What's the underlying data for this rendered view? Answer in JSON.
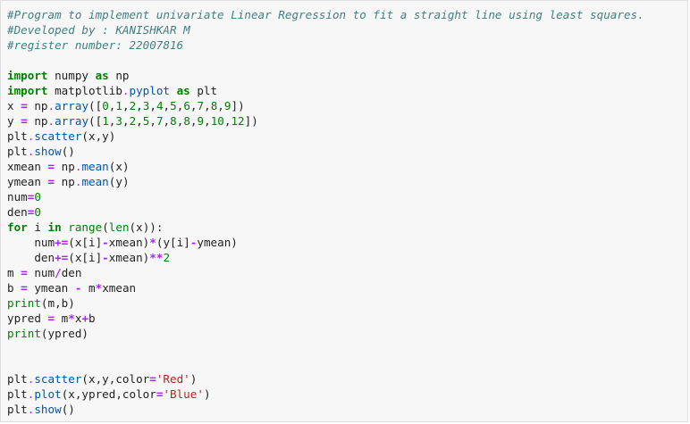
{
  "cell": {
    "lines": [
      [
        {
          "t": "comment",
          "v": "#Program to implement univariate Linear Regression to fit a straight line using least squares."
        }
      ],
      [
        {
          "t": "comment",
          "v": "#Developed by : KANISHKAR M"
        }
      ],
      [
        {
          "t": "comment",
          "v": "#register number: 22007816"
        }
      ],
      [],
      [
        {
          "t": "kw",
          "v": "import"
        },
        {
          "t": "text",
          "v": " numpy "
        },
        {
          "t": "kw",
          "v": "as"
        },
        {
          "t": "text",
          "v": " np"
        }
      ],
      [
        {
          "t": "kw",
          "v": "import"
        },
        {
          "t": "text",
          "v": " matplotlib"
        },
        {
          "t": "opn",
          "v": "."
        },
        {
          "t": "attr",
          "v": "pyplot"
        },
        {
          "t": "text",
          "v": " "
        },
        {
          "t": "kw",
          "v": "as"
        },
        {
          "t": "text",
          "v": " plt"
        }
      ],
      [
        {
          "t": "text",
          "v": "x "
        },
        {
          "t": "op",
          "v": "="
        },
        {
          "t": "text",
          "v": " np"
        },
        {
          "t": "opn",
          "v": "."
        },
        {
          "t": "attr",
          "v": "array"
        },
        {
          "t": "text",
          "v": "(["
        },
        {
          "t": "num",
          "v": "0"
        },
        {
          "t": "text",
          "v": ","
        },
        {
          "t": "num",
          "v": "1"
        },
        {
          "t": "text",
          "v": ","
        },
        {
          "t": "num",
          "v": "2"
        },
        {
          "t": "text",
          "v": ","
        },
        {
          "t": "num",
          "v": "3"
        },
        {
          "t": "text",
          "v": ","
        },
        {
          "t": "num",
          "v": "4"
        },
        {
          "t": "text",
          "v": ","
        },
        {
          "t": "num",
          "v": "5"
        },
        {
          "t": "text",
          "v": ","
        },
        {
          "t": "num",
          "v": "6"
        },
        {
          "t": "text",
          "v": ","
        },
        {
          "t": "num",
          "v": "7"
        },
        {
          "t": "text",
          "v": ","
        },
        {
          "t": "num",
          "v": "8"
        },
        {
          "t": "text",
          "v": ","
        },
        {
          "t": "num",
          "v": "9"
        },
        {
          "t": "text",
          "v": "])"
        }
      ],
      [
        {
          "t": "text",
          "v": "y "
        },
        {
          "t": "op",
          "v": "="
        },
        {
          "t": "text",
          "v": " np"
        },
        {
          "t": "opn",
          "v": "."
        },
        {
          "t": "attr",
          "v": "array"
        },
        {
          "t": "text",
          "v": "(["
        },
        {
          "t": "num",
          "v": "1"
        },
        {
          "t": "text",
          "v": ","
        },
        {
          "t": "num",
          "v": "3"
        },
        {
          "t": "text",
          "v": ","
        },
        {
          "t": "num",
          "v": "2"
        },
        {
          "t": "text",
          "v": ","
        },
        {
          "t": "num",
          "v": "5"
        },
        {
          "t": "text",
          "v": ","
        },
        {
          "t": "num",
          "v": "7"
        },
        {
          "t": "text",
          "v": ","
        },
        {
          "t": "num",
          "v": "8"
        },
        {
          "t": "text",
          "v": ","
        },
        {
          "t": "num",
          "v": "8"
        },
        {
          "t": "text",
          "v": ","
        },
        {
          "t": "num",
          "v": "9"
        },
        {
          "t": "text",
          "v": ","
        },
        {
          "t": "num",
          "v": "10"
        },
        {
          "t": "text",
          "v": ","
        },
        {
          "t": "num",
          "v": "12"
        },
        {
          "t": "text",
          "v": "])"
        }
      ],
      [
        {
          "t": "text",
          "v": "plt"
        },
        {
          "t": "opn",
          "v": "."
        },
        {
          "t": "attr",
          "v": "scatter"
        },
        {
          "t": "text",
          "v": "(x,y)"
        }
      ],
      [
        {
          "t": "text",
          "v": "plt"
        },
        {
          "t": "opn",
          "v": "."
        },
        {
          "t": "attr",
          "v": "show"
        },
        {
          "t": "text",
          "v": "()"
        }
      ],
      [
        {
          "t": "text",
          "v": "xmean "
        },
        {
          "t": "op",
          "v": "="
        },
        {
          "t": "text",
          "v": " np"
        },
        {
          "t": "opn",
          "v": "."
        },
        {
          "t": "attr",
          "v": "mean"
        },
        {
          "t": "text",
          "v": "(x)"
        }
      ],
      [
        {
          "t": "text",
          "v": "ymean "
        },
        {
          "t": "op",
          "v": "="
        },
        {
          "t": "text",
          "v": " np"
        },
        {
          "t": "opn",
          "v": "."
        },
        {
          "t": "attr",
          "v": "mean"
        },
        {
          "t": "text",
          "v": "(y)"
        }
      ],
      [
        {
          "t": "text",
          "v": "num"
        },
        {
          "t": "op",
          "v": "="
        },
        {
          "t": "num",
          "v": "0"
        }
      ],
      [
        {
          "t": "text",
          "v": "den"
        },
        {
          "t": "op",
          "v": "="
        },
        {
          "t": "num",
          "v": "0"
        }
      ],
      [
        {
          "t": "kw",
          "v": "for"
        },
        {
          "t": "text",
          "v": " i "
        },
        {
          "t": "kw",
          "v": "in"
        },
        {
          "t": "text",
          "v": " "
        },
        {
          "t": "builtin",
          "v": "range"
        },
        {
          "t": "text",
          "v": "("
        },
        {
          "t": "builtin",
          "v": "len"
        },
        {
          "t": "text",
          "v": "(x)):"
        }
      ],
      [
        {
          "t": "text",
          "v": "    num"
        },
        {
          "t": "op",
          "v": "+="
        },
        {
          "t": "text",
          "v": "(x[i]"
        },
        {
          "t": "op",
          "v": "-"
        },
        {
          "t": "text",
          "v": "xmean)"
        },
        {
          "t": "op",
          "v": "*"
        },
        {
          "t": "text",
          "v": "(y[i]"
        },
        {
          "t": "op",
          "v": "-"
        },
        {
          "t": "text",
          "v": "ymean)"
        }
      ],
      [
        {
          "t": "text",
          "v": "    den"
        },
        {
          "t": "op",
          "v": "+="
        },
        {
          "t": "text",
          "v": "(x[i]"
        },
        {
          "t": "op",
          "v": "-"
        },
        {
          "t": "text",
          "v": "xmean)"
        },
        {
          "t": "op",
          "v": "**"
        },
        {
          "t": "num",
          "v": "2"
        }
      ],
      [
        {
          "t": "text",
          "v": "m "
        },
        {
          "t": "op",
          "v": "="
        },
        {
          "t": "text",
          "v": " num"
        },
        {
          "t": "op",
          "v": "/"
        },
        {
          "t": "text",
          "v": "den"
        }
      ],
      [
        {
          "t": "text",
          "v": "b "
        },
        {
          "t": "op",
          "v": "="
        },
        {
          "t": "text",
          "v": " ymean "
        },
        {
          "t": "op",
          "v": "-"
        },
        {
          "t": "text",
          "v": " m"
        },
        {
          "t": "op",
          "v": "*"
        },
        {
          "t": "text",
          "v": "xmean"
        }
      ],
      [
        {
          "t": "builtin",
          "v": "print"
        },
        {
          "t": "text",
          "v": "(m,b)"
        }
      ],
      [
        {
          "t": "text",
          "v": "ypred "
        },
        {
          "t": "op",
          "v": "="
        },
        {
          "t": "text",
          "v": " m"
        },
        {
          "t": "op",
          "v": "*"
        },
        {
          "t": "text",
          "v": "x"
        },
        {
          "t": "op",
          "v": "+"
        },
        {
          "t": "text",
          "v": "b"
        }
      ],
      [
        {
          "t": "builtin",
          "v": "print"
        },
        {
          "t": "text",
          "v": "(ypred)"
        }
      ],
      [],
      [],
      [
        {
          "t": "text",
          "v": "plt"
        },
        {
          "t": "opn",
          "v": "."
        },
        {
          "t": "attr",
          "v": "scatter"
        },
        {
          "t": "text",
          "v": "(x,y,color"
        },
        {
          "t": "op",
          "v": "="
        },
        {
          "t": "str",
          "v": "'Red'"
        },
        {
          "t": "text",
          "v": ")"
        }
      ],
      [
        {
          "t": "text",
          "v": "plt"
        },
        {
          "t": "opn",
          "v": "."
        },
        {
          "t": "attr",
          "v": "plot"
        },
        {
          "t": "text",
          "v": "(x,ypred,color"
        },
        {
          "t": "op",
          "v": "="
        },
        {
          "t": "str",
          "v": "'Blue'"
        },
        {
          "t": "text",
          "v": ")"
        }
      ],
      [
        {
          "t": "text",
          "v": "plt"
        },
        {
          "t": "opn",
          "v": "."
        },
        {
          "t": "attr",
          "v": "show"
        },
        {
          "t": "text",
          "v": "()"
        }
      ]
    ]
  }
}
